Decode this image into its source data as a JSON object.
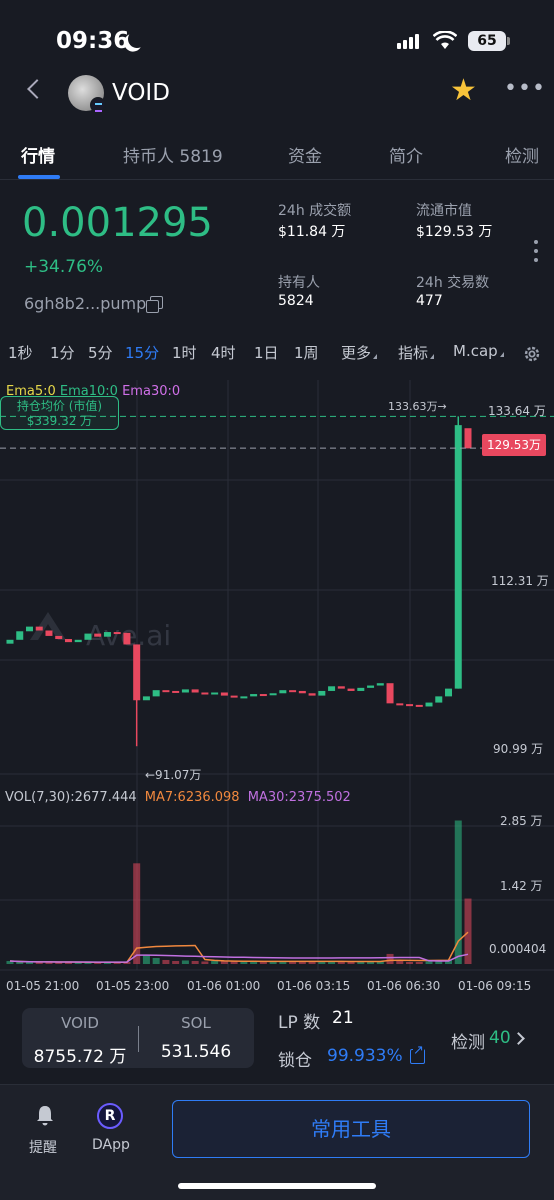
{
  "status_bar": {
    "time": "09:36",
    "battery": "65"
  },
  "header": {
    "token_name": "VOID"
  },
  "tabs": [
    {
      "label": "行情"
    },
    {
      "label": "持币人 5819"
    },
    {
      "label": "资金"
    },
    {
      "label": "简介"
    },
    {
      "label": "检测"
    }
  ],
  "summary": {
    "price": "0.001295",
    "change": "+34.76%",
    "address": "6gh8b2...pump",
    "stats": [
      {
        "label": "24h 成交额",
        "value": "$11.84 万"
      },
      {
        "label": "流通市值",
        "value": "$129.53 万"
      },
      {
        "label": "持有人",
        "value": "5824"
      },
      {
        "label": "24h 交易数",
        "value": "477"
      }
    ]
  },
  "intervals": {
    "items": [
      "1秒",
      "1分",
      "5分",
      "15分",
      "1时",
      "4时",
      "1日",
      "1周"
    ],
    "active": "15分",
    "more": "更多",
    "indicators": "指标",
    "mcap": "M.cap"
  },
  "chart": {
    "ema_legend": {
      "ema5": "Ema5:0",
      "ema10": "Ema10:0",
      "ema30": "Ema30:0"
    },
    "hold_label": "持仓均价 (市值)",
    "hold_value": "$339.32 万",
    "watermark": "Ave.ai",
    "high_marker": "133.63万→",
    "low_marker": "←91.07万",
    "current_tag": "129.53万",
    "price_axis": [
      "133.64 万",
      "112.31 万",
      "90.99 万"
    ],
    "vol_legend": {
      "vol": "VOL(7,30):2677.444",
      "ma7": "MA7:6236.098",
      "ma30": "MA30:2375.502"
    },
    "vol_axis": [
      "2.85 万",
      "1.42 万",
      "0.000404"
    ],
    "time_axis": [
      "01-05 21:00",
      "01-05 23:00",
      "01-06 01:00",
      "01-06 03:15",
      "01-06 06:30",
      "01-06 09:15"
    ],
    "colors": {
      "up": "#2ebd85",
      "down": "#e8485f",
      "ema5": "#e6d84a",
      "ema10": "#2ebd85",
      "ema30": "#d070e8",
      "ma7": "#f0883e",
      "ma30": "#c070e0"
    }
  },
  "chart_data": {
    "type": "candlestick",
    "y_unit": "万 (market cap)",
    "ylim": [
      88,
      136
    ],
    "candles": [
      {
        "o": 104.3,
        "c": 104.8
      },
      {
        "o": 104.8,
        "c": 105.9
      },
      {
        "o": 105.9,
        "c": 106.5
      },
      {
        "o": 106.5,
        "c": 106.0
      },
      {
        "o": 106.0,
        "c": 105.3
      },
      {
        "o": 105.3,
        "c": 104.9
      },
      {
        "o": 104.9,
        "c": 104.5
      },
      {
        "o": 104.5,
        "c": 104.8
      },
      {
        "o": 104.8,
        "c": 105.6
      },
      {
        "o": 105.6,
        "c": 105.2
      },
      {
        "o": 105.2,
        "c": 105.8
      },
      {
        "o": 105.8,
        "c": 105.7
      },
      {
        "o": 105.7,
        "c": 104.2
      },
      {
        "o": 104.2,
        "c": 97.0
      },
      {
        "o": 97.0,
        "c": 97.5
      },
      {
        "o": 97.5,
        "c": 98.3
      },
      {
        "o": 98.3,
        "c": 98.2
      },
      {
        "o": 98.2,
        "c": 98.0
      },
      {
        "o": 98.0,
        "c": 98.4
      },
      {
        "o": 98.4,
        "c": 98.0
      },
      {
        "o": 98.0,
        "c": 97.8
      },
      {
        "o": 97.8,
        "c": 98.0
      },
      {
        "o": 98.0,
        "c": 97.6
      },
      {
        "o": 97.6,
        "c": 97.4
      },
      {
        "o": 97.4,
        "c": 97.5
      },
      {
        "o": 97.5,
        "c": 97.8
      },
      {
        "o": 97.8,
        "c": 97.7
      },
      {
        "o": 97.7,
        "c": 97.9
      },
      {
        "o": 97.9,
        "c": 98.3
      },
      {
        "o": 98.3,
        "c": 98.2
      },
      {
        "o": 98.2,
        "c": 97.9
      },
      {
        "o": 97.9,
        "c": 97.6
      },
      {
        "o": 97.6,
        "c": 98.2
      },
      {
        "o": 98.2,
        "c": 98.8
      },
      {
        "o": 98.8,
        "c": 98.5
      },
      {
        "o": 98.5,
        "c": 98.2
      },
      {
        "o": 98.2,
        "c": 98.6
      },
      {
        "o": 98.6,
        "c": 98.9
      },
      {
        "o": 98.9,
        "c": 99.2
      },
      {
        "o": 99.2,
        "c": 96.6
      },
      {
        "o": 96.6,
        "c": 96.5
      },
      {
        "o": 96.5,
        "c": 96.4
      },
      {
        "o": 96.4,
        "c": 96.2
      },
      {
        "o": 96.2,
        "c": 96.7
      },
      {
        "o": 96.7,
        "c": 97.5
      },
      {
        "o": 97.5,
        "c": 98.5
      },
      {
        "o": 98.5,
        "c": 132.5
      },
      {
        "o": 132.1,
        "c": 129.5
      }
    ],
    "wicks": {
      "13": [
        104.2,
        91.07
      ],
      "46": [
        98.5,
        133.63
      ]
    },
    "volume": [
      60,
      40,
      30,
      40,
      35,
      30,
      40,
      50,
      30,
      30,
      30,
      30,
      40,
      2000,
      180,
      120,
      80,
      60,
      70,
      60,
      50,
      60,
      50,
      50,
      50,
      50,
      50,
      50,
      60,
      50,
      50,
      50,
      50,
      50,
      50,
      50,
      50,
      50,
      50,
      200,
      60,
      40,
      40,
      50,
      60,
      80,
      2850,
      1300
    ],
    "vol_ylim": [
      0,
      2900
    ]
  },
  "pool": {
    "token": "VOID",
    "token_amount": "8755.72 万",
    "quote": "SOL",
    "quote_amount": "531.546"
  },
  "lp": {
    "label": "LP 数",
    "value": "21"
  },
  "lock": {
    "label": "锁仓",
    "value": "99.933%"
  },
  "check": {
    "label": "检测",
    "value": "40"
  },
  "bottom_nav": {
    "remind": "提醒",
    "dapp": "DApp",
    "dapp_letter": "R",
    "tools": "常用工具"
  }
}
